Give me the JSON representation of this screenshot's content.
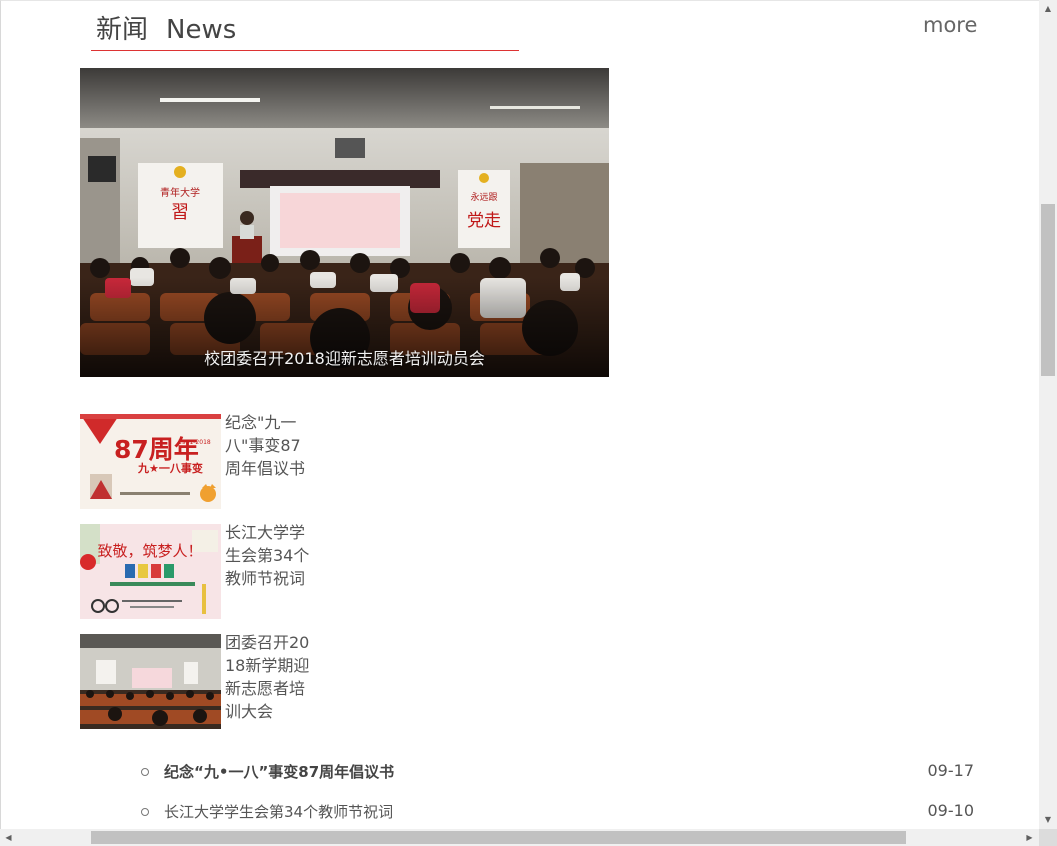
{
  "header": {
    "title_cn": "新闻",
    "title_en": "News",
    "more_label": "more",
    "accent_color": "#d33333"
  },
  "feature": {
    "caption": "校团委召开2018迎新志愿者培训动员会",
    "banner_left": "青年大学习",
    "banner_right": "永远跟党走"
  },
  "thumbs": [
    {
      "title": "纪念\"九一八\"事变87周年倡议书",
      "poster_big": "87周年",
      "poster_small": "九★一八事变",
      "poster_years": "1931-2018"
    },
    {
      "title": "长江大学学生会第34个教师节祝词",
      "poster_big": "致敬，筑梦人！"
    },
    {
      "title": "团委召开2018新学期迎新志愿者培训大会"
    }
  ],
  "list": [
    {
      "title": "纪念“九•一八”事变87周年倡议书",
      "date": "09-17",
      "bold": true
    },
    {
      "title": "长江大学学生会第34个教师节祝词",
      "date": "09-10",
      "bold": false
    }
  ],
  "icons": {
    "up": "▲",
    "down": "▼",
    "left": "◀",
    "right": "▶"
  }
}
